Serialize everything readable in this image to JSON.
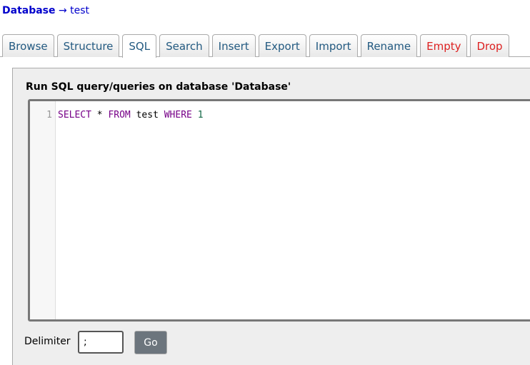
{
  "breadcrumb": {
    "database": "Database",
    "arrow": "→",
    "table": "test"
  },
  "tabs": [
    {
      "label": "Browse"
    },
    {
      "label": "Structure"
    },
    {
      "label": "SQL"
    },
    {
      "label": "Search"
    },
    {
      "label": "Insert"
    },
    {
      "label": "Export"
    },
    {
      "label": "Import"
    },
    {
      "label": "Rename"
    },
    {
      "label": "Empty"
    },
    {
      "label": "Drop"
    }
  ],
  "active_tab": "SQL",
  "panel": {
    "title": "Run SQL query/queries on database 'Database'"
  },
  "editor": {
    "line_number": "1",
    "tokens": {
      "select": "SELECT",
      "star": " * ",
      "from": "FROM",
      "table": " test ",
      "where": "WHERE",
      "space": " ",
      "one": "1"
    }
  },
  "delimiter": {
    "label": "Delimiter",
    "value": ";"
  },
  "go_button": {
    "label": "Go"
  },
  "colors": {
    "link": "#0000cc",
    "tab_text": "#235a81",
    "danger_tab": "#dd2222",
    "sql_keyword": "#770088",
    "sql_number": "#116644",
    "go_button_bg": "#6c757d"
  }
}
